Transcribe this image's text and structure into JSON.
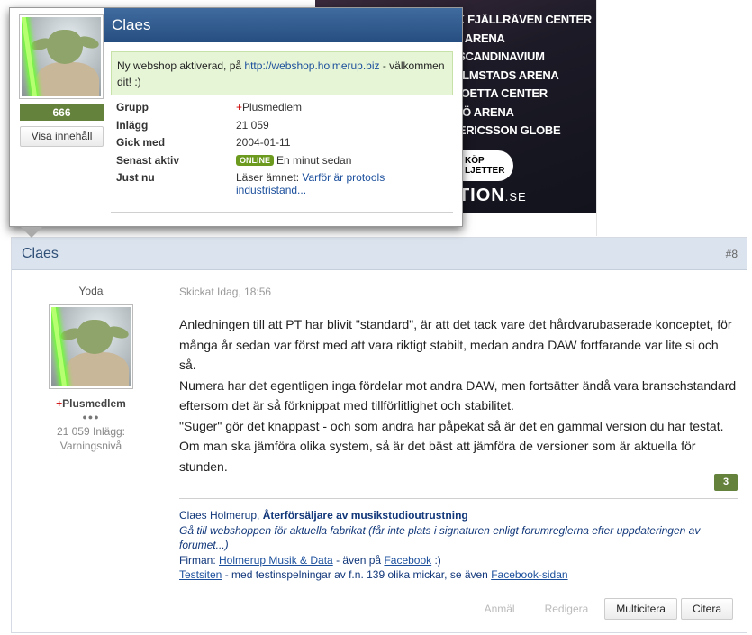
{
  "ad": {
    "venues": [
      "VIK FJÄLLRÄVEN CENTER",
      "OP ARENA",
      "G SCANDINAVIUM",
      "HALMSTADS ARENA",
      "CLOETTA CENTER",
      "LMÖ ARENA",
      "M ERICSSON GLOBE"
    ],
    "buy_label_1": "KÖP",
    "buy_label_2": "LJETTER",
    "brand": "ATION",
    "brand_suffix": ".SE"
  },
  "popup": {
    "username": "Claes",
    "score": "666",
    "view_content_button": "Visa innehåll",
    "notice_text": "Ny webshop aktiverad, på ",
    "notice_link": "http://webshop.holmerup.biz",
    "notice_text_after": " - välkommen dit! :)",
    "fields": {
      "group_label": "Grupp",
      "group_plus": "+",
      "group_value": "Plusmedlem",
      "posts_label": "Inlägg",
      "posts_value": "21 059",
      "joined_label": "Gick med",
      "joined_value": "2004-01-11",
      "last_active_label": "Senast aktiv",
      "online_badge": "ONLINE",
      "last_active_value": "En minut sedan",
      "just_now_label": "Just nu",
      "just_now_prefix": "Läser ämnet: ",
      "just_now_link": "Varför är protools industristand..."
    }
  },
  "post": {
    "author": "Claes",
    "number": "#8",
    "user_title": "Yoda",
    "group_plus": "+",
    "group": "Plusmedlem",
    "rank_dots": "●●●",
    "post_count": "21 059 Inlägg:",
    "warning_level": "Varningsnivå",
    "sent": "Skickat Idag, 18:56",
    "body": [
      "Anledningen till att PT har blivit \"standard\", är att det tack vare det hårdvarubaserade konceptet, för många år sedan var först med att vara riktigt stabilt, medan andra DAW fortfarande var lite si och så.",
      "Numera har det egentligen inga fördelar mot andra DAW, men fortsätter ändå vara branschstandard eftersom det är så förknippat med tillförlitlighet och stabilitet.",
      "\"Suger\" gör det knappast - och som andra har påpekat så är det en gammal version du har testat.",
      "Om man ska jämföra olika system, så är det bäst att jämföra de versioner som är aktuella för stunden."
    ],
    "likes": "3",
    "signature": {
      "line1_name": "Claes Holmerup, ",
      "line1_company": "Återförsäljare av musikstudioutrustning",
      "line2": "Gå till webshoppen för aktuella fabrikat (får inte plats i signaturen enligt forumreglerna efter uppdateringen av forumet...)",
      "line3_prefix": "Firman: ",
      "line3_link1": "Holmerup Musik & Data",
      "line3_mid": " - även på  ",
      "line3_link2": "Facebook",
      "line3_suffix": " :)",
      "line4_link1": "Testsiten",
      "line4_mid": " - med testinspelningar av f.n. 139 olika mickar, se även ",
      "line4_link2": "Facebook-sidan"
    },
    "actions": {
      "report": "Anmäl",
      "edit": "Redigera",
      "multiquote": "Multicitera",
      "quote": "Citera"
    }
  },
  "colors": {
    "header_blue": "#274e80",
    "like_green": "#64823c",
    "online_green": "#6c9a1f",
    "notice_bg": "#e6f5d6"
  }
}
